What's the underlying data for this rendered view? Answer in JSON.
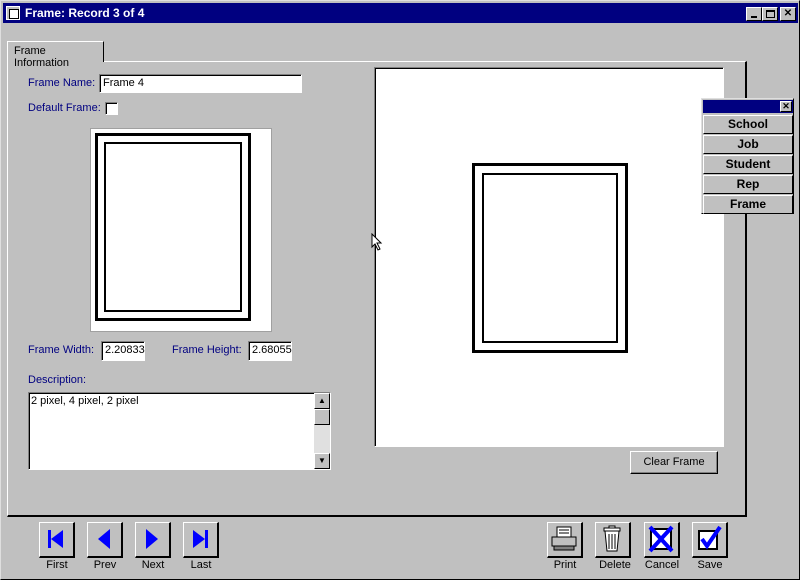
{
  "window": {
    "title": "Frame: Record 3 of 4"
  },
  "tabs": [
    {
      "label": "Frame Information"
    }
  ],
  "form": {
    "frame_name_label": "Frame Name:",
    "frame_name_value": "Frame 4",
    "default_frame_label": "Default Frame:",
    "default_frame_checked": false,
    "frame_width_label": "Frame Width:",
    "frame_width_value": "2.20833",
    "frame_height_label": "Frame Height:",
    "frame_height_value": "2.68055",
    "description_label": "Description:",
    "description_value": "2 pixel, 4 pixel, 2 pixel"
  },
  "preview": {
    "clear_button": "Clear Frame"
  },
  "palette": {
    "items": [
      "School",
      "Job",
      "Student",
      "Rep",
      "Frame"
    ]
  },
  "nav": {
    "first": "First",
    "prev": "Prev",
    "next": "Next",
    "last": "Last"
  },
  "actions": {
    "print": "Print",
    "delete": "Delete",
    "cancel": "Cancel",
    "save": "Save"
  },
  "colors": {
    "titlebar": "#000080",
    "label": "#000080",
    "icon_blue": "#0000ff",
    "face": "#c0c0c0"
  }
}
